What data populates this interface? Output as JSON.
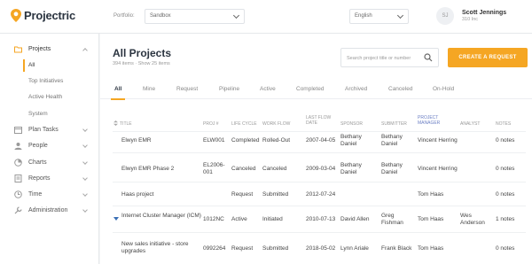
{
  "app": {
    "name": "Projectric"
  },
  "header": {
    "portfolio_label": "Portfolio:",
    "portfolio_value": "Sandbox",
    "language_value": "English",
    "user_initials": "SJ",
    "user_name": "Scott Jennings",
    "user_org": "310 Inc"
  },
  "sidebar": {
    "projects": "Projects",
    "sub": [
      "All",
      "Top Initiatives",
      "Active Health",
      "System"
    ],
    "items": [
      "Plan Tasks",
      "People",
      "Charts",
      "Reports",
      "Time",
      "Administration"
    ]
  },
  "page": {
    "title": "All Projects",
    "subtitle": "394 items · Show 25 items",
    "search_placeholder": "Search project title or number",
    "cta": "CREATE A REQUEST"
  },
  "tabs": [
    "All",
    "Mine",
    "Request",
    "Pipeline",
    "Active",
    "Completed",
    "Archived",
    "Canceled",
    "On-Hold"
  ],
  "table": {
    "headers": {
      "title": "TITLE",
      "proj": "PROJ #",
      "lifecycle": "LIFE CYCLE",
      "workflow": "WORK FLOW",
      "last_flow_date": "LAST FLOW DATE",
      "sponsor": "SPONSOR",
      "submitter": "SUBMITTER",
      "pm": "PROJECT MANAGER",
      "analyst": "ANALYST",
      "notes": "NOTES"
    },
    "rows": [
      {
        "title": "Elwyn EMR",
        "proj": "ELW001",
        "lifecycle": "Completed",
        "workflow": "Rolled-Out",
        "date": "2007-04-05",
        "sponsor": "Bethany Daniel",
        "submitter": "Bethany Daniel",
        "pm": "Vincent Herring",
        "analyst": "",
        "notes": "0 notes"
      },
      {
        "title": "Elwyn EMR Phase 2",
        "proj": "EL2006-001",
        "lifecycle": "Canceled",
        "workflow": "Canceled",
        "date": "2009-03-04",
        "sponsor": "Bethany Daniel",
        "submitter": "Bethany Daniel",
        "pm": "Vincent Herring",
        "analyst": "",
        "notes": "0 notes"
      },
      {
        "title": "Haas project",
        "proj": "",
        "lifecycle": "Request",
        "workflow": "Submitted",
        "date": "2012-07-24",
        "sponsor": "",
        "submitter": "",
        "pm": "Tom Haas",
        "analyst": "",
        "notes": "0 notes"
      },
      {
        "title": "Internet Cluster Manager (ICM)",
        "proj": "1012NC",
        "lifecycle": "Active",
        "workflow": "Initiated",
        "date": "2010-07-13",
        "sponsor": "David Allen",
        "submitter": "Greg Fishman",
        "pm": "Tom Haas",
        "analyst": "Wes Anderson",
        "notes": "1 notes"
      },
      {
        "title": "New sales initiative - store upgrades",
        "proj": "0992264",
        "lifecycle": "Request",
        "workflow": "Submitted",
        "date": "2018-05-02",
        "sponsor": "Lynn Ariale",
        "submitter": "Frank Black",
        "pm": "Tom Haas",
        "analyst": "",
        "notes": "0 notes"
      }
    ]
  },
  "colors": {
    "accent": "#f5a623",
    "link": "#6b7fc4"
  }
}
